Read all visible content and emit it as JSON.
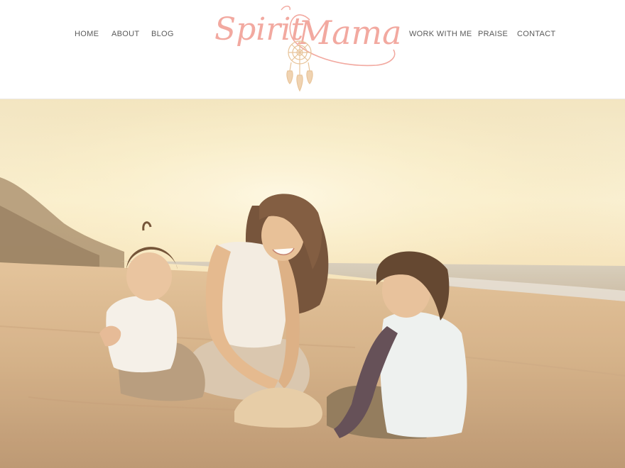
{
  "site": {
    "logo_text": "Spirit Mama",
    "logo_word_1": "Spirit",
    "logo_word_2": "Mama"
  },
  "nav": {
    "left": [
      {
        "label": "HOME"
      },
      {
        "label": "ABOUT"
      },
      {
        "label": "BLOG"
      }
    ],
    "right": [
      {
        "label": "WORK WITH ME"
      },
      {
        "label": "PRAISE"
      },
      {
        "label": "CONTACT"
      }
    ]
  },
  "colors": {
    "logo_pink": "#f2a9a0",
    "dreamcatcher_gold": "#e8c49a",
    "nav_text": "#5a5a5a"
  },
  "hero": {
    "image_alt": "Mother laughing with two young children in the sand on a beach at sunset"
  }
}
